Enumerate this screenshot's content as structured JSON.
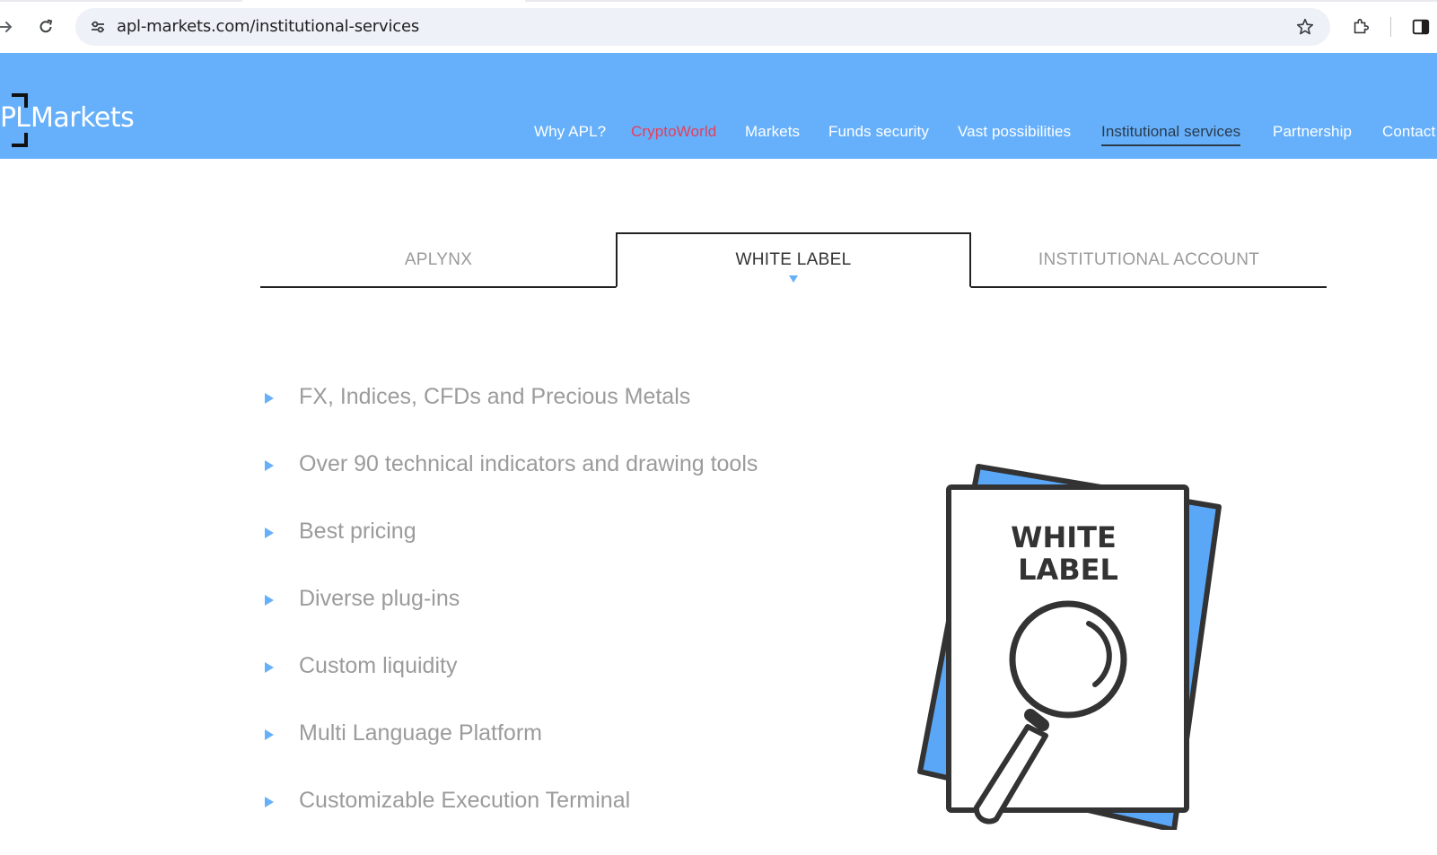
{
  "browser": {
    "url": "apl-markets.com/institutional-services",
    "icons": [
      "forward-icon",
      "reload-icon",
      "site-settings-icon",
      "bookmark-star-icon",
      "extensions-icon",
      "side-panel-icon"
    ]
  },
  "site": {
    "logo_prefix": "PL",
    "logo_text": "Markets",
    "header_color": "#66b0fb",
    "nav": [
      {
        "label": "Why APL?"
      },
      {
        "label": "CryptoWorld",
        "color": "#e63d5a"
      },
      {
        "label": "Markets"
      },
      {
        "label": "Funds security"
      },
      {
        "label": "Vast possibilities"
      },
      {
        "label": "Institutional services",
        "active": true
      },
      {
        "label": "Partnership"
      },
      {
        "label": "Contact"
      }
    ]
  },
  "tabs": [
    {
      "label": "APLYNX"
    },
    {
      "label": "WHITE LABEL",
      "active": true
    },
    {
      "label": "INSTITUTIONAL ACCOUNT"
    }
  ],
  "features": [
    "FX, Indices, CFDs and Precious Metals",
    "Over 90 technical indicators and drawing tools",
    "Best pricing",
    "Diverse plug-ins",
    "Custom liquidity",
    "Multi Language Platform",
    "Customizable Execution Terminal"
  ],
  "illustration": {
    "line1": "WHITE",
    "line2": "LABEL",
    "accent": "#5aa7f7"
  }
}
